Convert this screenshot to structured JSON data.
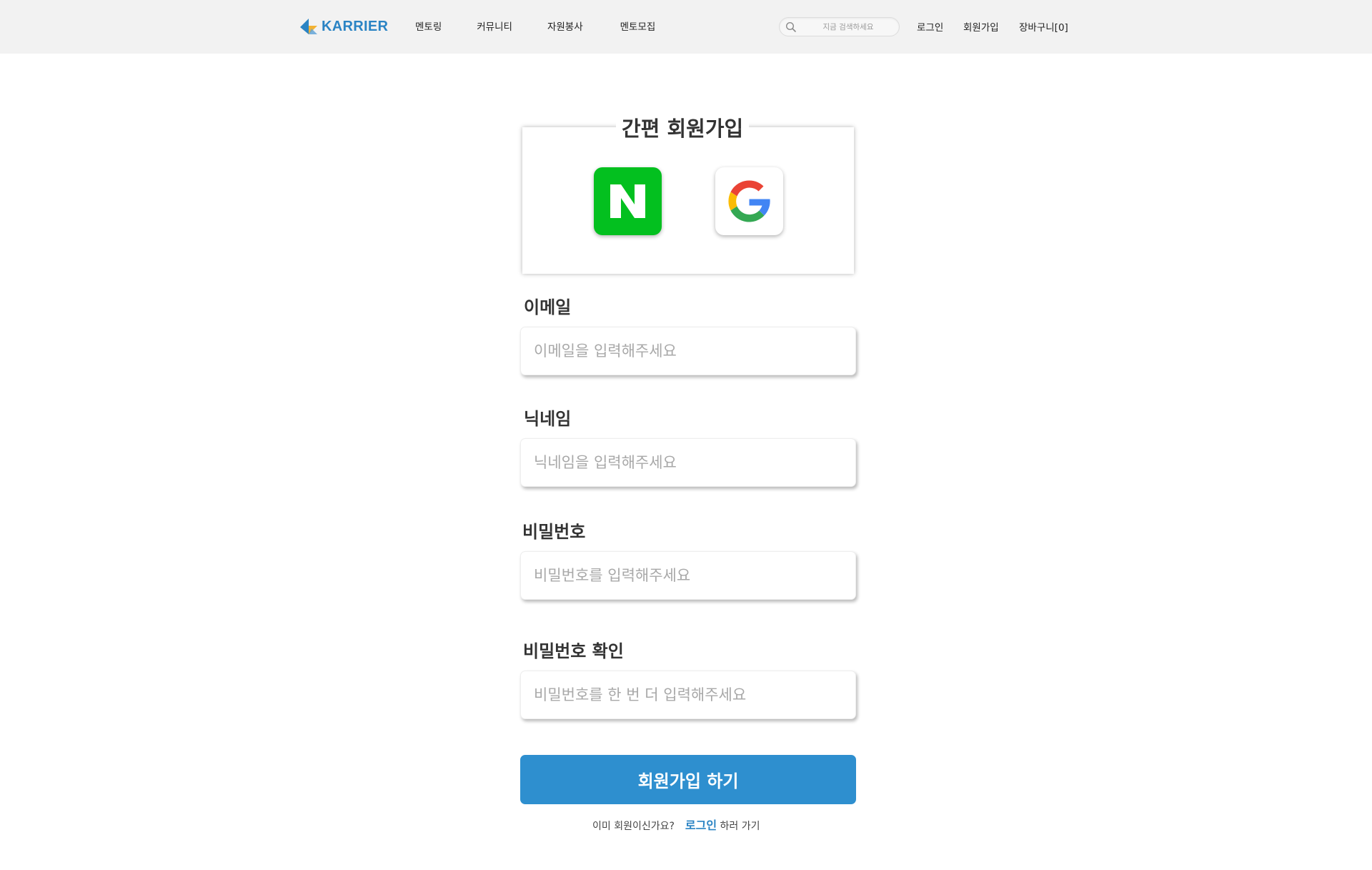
{
  "header": {
    "logo_text": "KARRIER",
    "nav": [
      {
        "label": "멘토링"
      },
      {
        "label": "커뮤니티"
      },
      {
        "label": "자원봉사"
      },
      {
        "label": "멘토모집"
      }
    ],
    "search": {
      "placeholder": "지금 검색하세요",
      "icon": "search-icon"
    },
    "login": "로그인",
    "signup": "회원가입",
    "cart": "장바구니[0]"
  },
  "social": {
    "title": "간편 회원가입",
    "naver": {
      "icon": "naver-logo-icon",
      "letter": "N",
      "color": "#03c01f"
    },
    "google": {
      "icon": "google-logo-icon",
      "colors": [
        "#ea4335",
        "#fbbc05",
        "#34a853",
        "#4285f4"
      ]
    }
  },
  "form": {
    "email": {
      "label": "이메일",
      "placeholder": "이메일을 입력해주세요"
    },
    "nickname": {
      "label": "닉네임",
      "placeholder": "닉네임을 입력해주세요"
    },
    "password": {
      "label": "비밀번호",
      "placeholder": "비밀번호를 입력해주세요"
    },
    "password_confirm": {
      "label": "비밀번호 확인",
      "placeholder": "비밀번호를 한 번 더 입력해주세요"
    },
    "submit": "회원가입 하기"
  },
  "footer": {
    "question": "이미 회원이신가요?",
    "login_link": "로그인",
    "suffix": " 하러 가기"
  },
  "colors": {
    "brand": "#2b84c4",
    "button": "#2e8fcf",
    "header_bg": "#f2f2f2",
    "naver": "#03c01f"
  }
}
